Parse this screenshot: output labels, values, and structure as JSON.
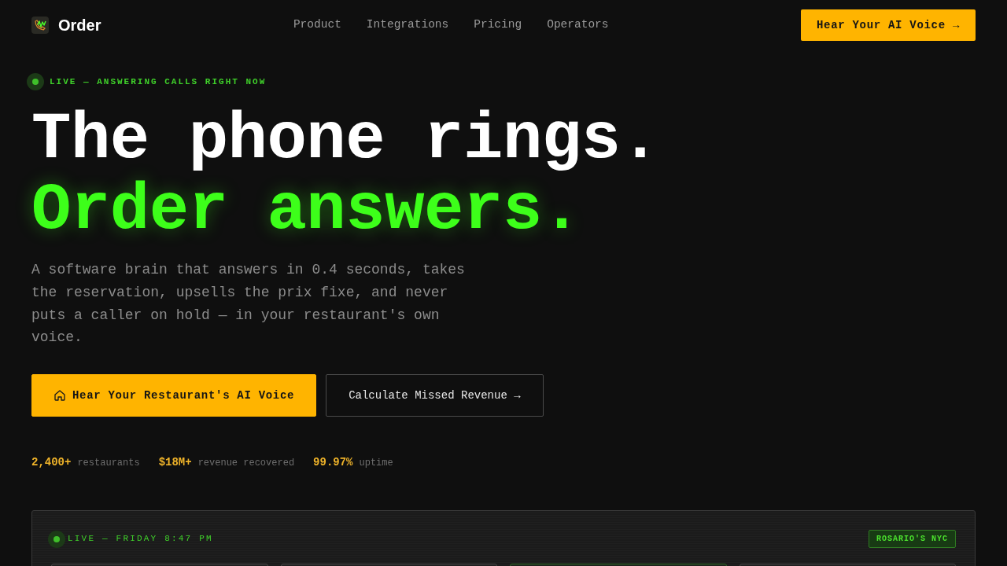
{
  "nav": {
    "logo": "Order",
    "links": [
      "Product",
      "Integrations",
      "Pricing",
      "Operators"
    ],
    "cta": "Hear Your AI Voice →"
  },
  "hero": {
    "status": "LIVE — ANSWERING CALLS RIGHT NOW",
    "headline": [
      {
        "text": "The phone rings.",
        "kind": "plain"
      },
      {
        "text": "Order answers.",
        "kind": "accent"
      }
    ],
    "description": "A software brain that answers in 0.4 seconds, takes the reservation, upsells the prix fixe, and never puts a caller on hold — in your restaurant's own voice.",
    "buttons": [
      {
        "label": "Hear Your Restaurant's AI Voice",
        "kind": "primary"
      },
      {
        "label": "Calculate Missed Revenue →",
        "kind": "secondary"
      }
    ],
    "stats": [
      {
        "value": "2,400+",
        "label": "restaurants"
      },
      {
        "value": "$18M+",
        "label": "revenue recovered"
      },
      {
        "value": "99.97%",
        "label": "uptime"
      }
    ]
  },
  "live_panel": {
    "status": "LIVE — FRIDAY 8:47 PM",
    "location": "ROSARIO'S NYC",
    "cards": [
      {
        "active": false
      },
      {
        "active": false
      },
      {
        "active": true
      },
      {
        "active": false
      }
    ]
  }
}
